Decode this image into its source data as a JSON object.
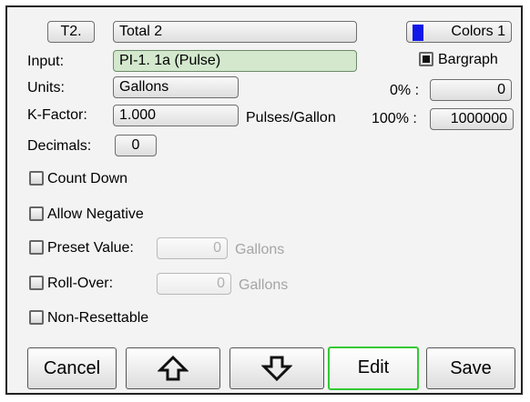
{
  "header": {
    "tag_button": "T2.",
    "name_value": "Total 2",
    "colors_button": "Colors 1",
    "colors_swatch": "#1018e8"
  },
  "form": {
    "input_label": "Input:",
    "input_value": "PI-1. 1a (Pulse)",
    "units_label": "Units:",
    "units_value": "Gallons",
    "kfactor_label": "K-Factor:",
    "kfactor_value": "1.000",
    "kfactor_unit": "Pulses/Gallon",
    "decimals_label": "Decimals:",
    "decimals_value": "0"
  },
  "bargraph": {
    "label": "Bargraph",
    "checked": true,
    "zero_label": "0% :",
    "zero_value": "0",
    "full_label": "100% :",
    "full_value": "1000000"
  },
  "options": {
    "count_down": {
      "label": "Count Down",
      "checked": false
    },
    "allow_negative": {
      "label": "Allow Negative",
      "checked": false
    },
    "preset_value": {
      "label": "Preset Value:",
      "checked": false,
      "value": "0",
      "unit": "Gallons"
    },
    "roll_over": {
      "label": "Roll-Over:",
      "checked": false,
      "value": "0",
      "unit": "Gallons"
    },
    "non_resettable": {
      "label": "Non-Resettable",
      "checked": false
    }
  },
  "footer": {
    "cancel": "Cancel",
    "up_icon": "arrow-up-icon",
    "down_icon": "arrow-down-icon",
    "edit": "Edit",
    "save": "Save",
    "active_border": "#34c934"
  }
}
